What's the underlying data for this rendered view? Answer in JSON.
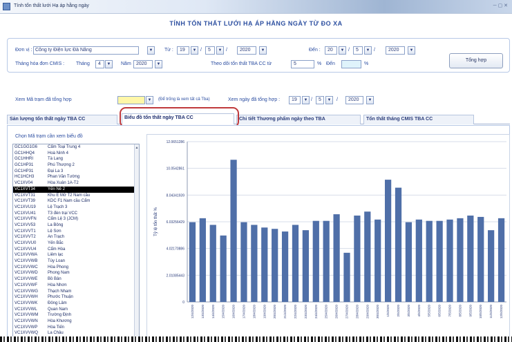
{
  "window": {
    "title": "Tính tổn thất lưới Hạ áp hằng ngày"
  },
  "form": {
    "heading": "TÍNH TỔN THẤT LƯỚI HẠ ÁP HẰNG NGÀY TỪ ĐO XA"
  },
  "params": {
    "unit_label": "Đơn vị :",
    "unit_value": "Công ty Điện lực Đà Nẵng",
    "from_label": "Từ :",
    "from_day": "19",
    "from_month": "5",
    "from_year": "2020",
    "to_label": "Đến :",
    "to_day": "20",
    "to_month": "5",
    "to_year": "2020",
    "summary_button": "Tổng hợp",
    "cmis_label": "Tháng hóa đơn CMIS :",
    "month_label": "Tháng",
    "month_value": "4",
    "year_label": "Năm",
    "year_value": "2020",
    "track_label": "Theo dõi tổn thất TBA CC từ",
    "track_from": "5",
    "percent_1": "%",
    "to2_label": "Đến",
    "track_to": "",
    "percent_2": "%"
  },
  "filter": {
    "station_label": "Xem Mã trạm đã tổng hợp",
    "station_value": "",
    "note": "(Để trống là xem tất cả Tba)",
    "date_label": "Xem ngày đã tổng hợp :",
    "day": "19",
    "month": "5",
    "year": "2020"
  },
  "tabs": [
    {
      "label": "Sản lượng tổn thất ngày TBA CC"
    },
    {
      "label": "Biểu đồ tổn thất ngày TBA CC"
    },
    {
      "label": "Chi tiết Thương phẩm ngày theo TBA"
    },
    {
      "label": "Tổn thất tháng CMIS TBA CC"
    }
  ],
  "list": {
    "caption": "Chọn Mã trạm cần xem biểu đồ",
    "items": [
      {
        "code": "GC1GG1G6",
        "name": "Cẩm Toại Trung 4"
      },
      {
        "code": "GC1HHQ4",
        "name": "Hoà Ninh 4"
      },
      {
        "code": "GC1HHRI",
        "name": "Tà Lang"
      },
      {
        "code": "GC1HP31",
        "name": "Phú Thượng 2"
      },
      {
        "code": "GC1HP31",
        "name": "Đại La 3"
      },
      {
        "code": "HC1HCH3",
        "name": "Phan Văn Tường"
      },
      {
        "code": "VC1XV04",
        "name": "Hòa Xuân 1A-T2"
      },
      {
        "code": "VC1XVT34",
        "name": "Yến Nê 2",
        "selected": true
      },
      {
        "code": "VC1XVT31",
        "name": "Khu E Mở T2 Nam cầu"
      },
      {
        "code": "VC1XVT39",
        "name": "KDC F1 Nam cầu Cẩm"
      },
      {
        "code": "VC1XVU19",
        "name": "Lệ Trạch 3"
      },
      {
        "code": "VC1XVU41",
        "name": "T3 đèn trại VCC"
      },
      {
        "code": "VC1XVVFN",
        "name": "Cẩm Lệ 3 (JCM)"
      },
      {
        "code": "VC1XVV53",
        "name": "La Bông"
      },
      {
        "code": "VC1XVVT1",
        "name": "Lệ Sơn"
      },
      {
        "code": "VC1XVVT2",
        "name": "An Trạch"
      },
      {
        "code": "VC1XVVU0",
        "name": "Yến Bắc"
      },
      {
        "code": "VC1XVVU4",
        "name": "Cẩm Hòa"
      },
      {
        "code": "VC1XVVWA",
        "name": "Liêm lạc"
      },
      {
        "code": "VC1XVVWB",
        "name": "Túy Loan"
      },
      {
        "code": "VC1XVVWC",
        "name": "Hòa Phong"
      },
      {
        "code": "VC1XVVWD",
        "name": "Phong Nam"
      },
      {
        "code": "VC1XVVWE",
        "name": "Bồ Bản"
      },
      {
        "code": "VC1XVVWF",
        "name": "Hòa Nhơn"
      },
      {
        "code": "VC1XVVWG",
        "name": "Thạch Nham"
      },
      {
        "code": "VC1XVVWH",
        "name": "Phước Thuận"
      },
      {
        "code": "VC1XVVWK",
        "name": "Đông Lâm"
      },
      {
        "code": "VC1XVVWL",
        "name": "Quan Nam"
      },
      {
        "code": "VC1XVVWM",
        "name": "Trường Định"
      },
      {
        "code": "VC1XVVWN",
        "name": "Hòa Khương"
      },
      {
        "code": "VC1XVVWP",
        "name": "Hòa Tiến"
      },
      {
        "code": "VC1XVVWQ",
        "name": "La Châu"
      }
    ]
  },
  "chart_data": {
    "type": "bar",
    "ylabel": "Tỷ lệ tổn thất %",
    "ylim": [
      0,
      12.06512861
    ],
    "yticks": [
      "0",
      "2.01085443",
      "4.02170886",
      "6.03256429",
      "8.04341939",
      "10.0542861",
      "12.0651286"
    ],
    "categories": [
      "12/4/2020",
      "13/4/2020",
      "14/4/2020",
      "15/4/2020",
      "16/4/2020",
      "17/4/2020",
      "18/4/2020",
      "19/4/2020",
      "20/4/2020",
      "21/4/2020",
      "22/4/2020",
      "23/4/2020",
      "24/4/2020",
      "25/4/2020",
      "26/4/2020",
      "27/4/2020",
      "28/4/2020",
      "29/4/2020",
      "30/4/2020",
      "1/5/2020",
      "2/5/2020",
      "3/5/2020",
      "4/5/2020",
      "5/5/2020",
      "6/5/2020",
      "7/5/2020",
      "8/5/2020",
      "9/5/2020",
      "10/5/2020",
      "11/5/2020",
      "12/5/2020"
    ],
    "values": [
      6.0,
      6.3,
      5.8,
      5.0,
      10.7,
      6.0,
      5.8,
      5.6,
      5.5,
      5.3,
      5.8,
      5.4,
      6.1,
      6.1,
      6.6,
      3.7,
      6.5,
      6.8,
      6.2,
      9.2,
      8.6,
      6.0,
      6.2,
      6.1,
      6.1,
      6.2,
      6.3,
      6.5,
      6.4,
      5.4,
      6.3
    ],
    "bar_color": "#4f6fa8",
    "grid": true
  }
}
